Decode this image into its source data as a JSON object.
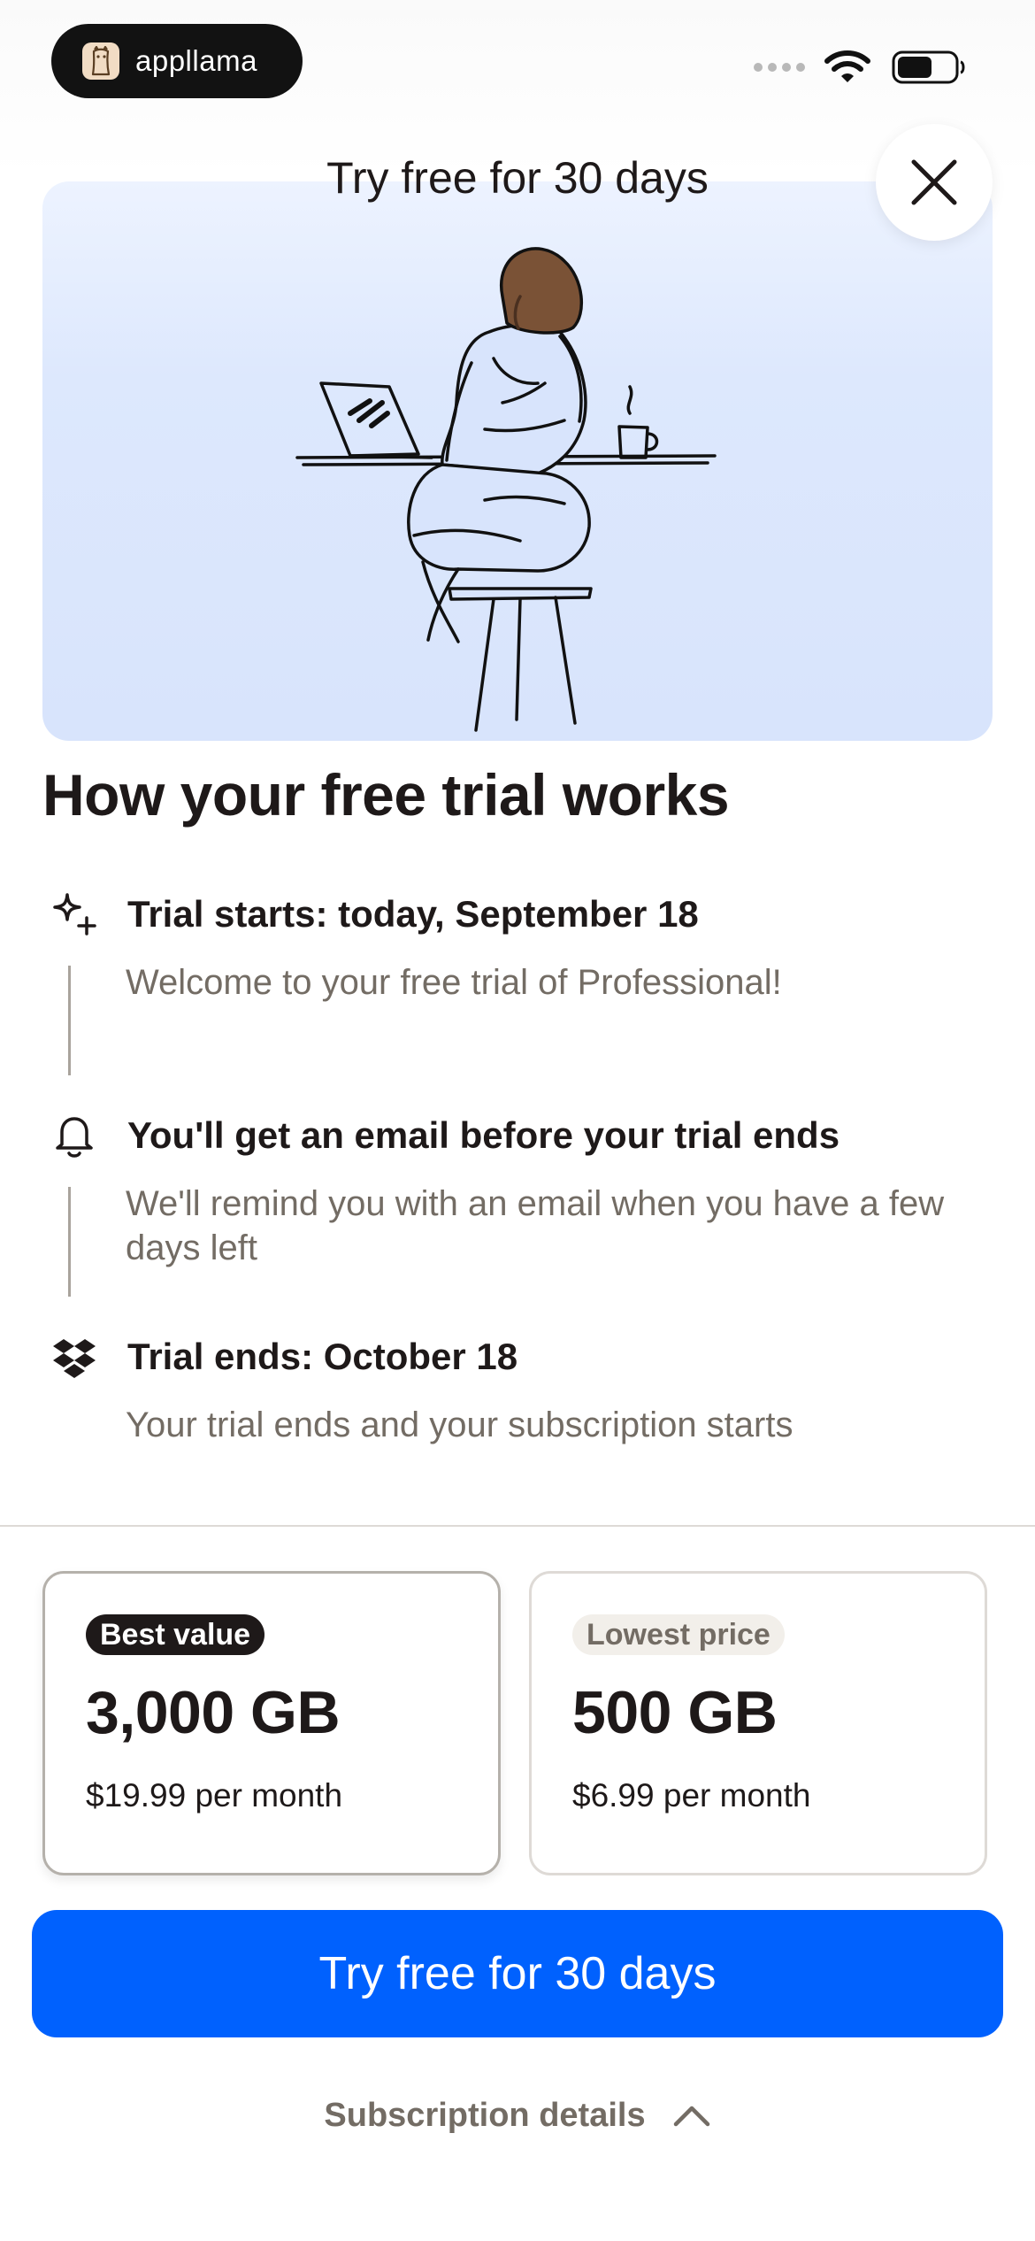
{
  "status_bar": {
    "brand_name": "appllama"
  },
  "header": {
    "title": "Try free for 30 days"
  },
  "how_it_works": {
    "title": "How your free trial works",
    "steps": [
      {
        "icon": "sparkle-icon",
        "title": "Trial starts: today, September 18",
        "description": "Welcome to your free trial of Professional!"
      },
      {
        "icon": "bell-icon",
        "title": "You'll get an email before your trial ends",
        "description": "We'll remind you with an email when you have a few days left"
      },
      {
        "icon": "dropbox-icon",
        "title": "Trial ends: October 18",
        "description": "Your trial ends and your subscription starts"
      }
    ]
  },
  "plans": [
    {
      "badge": "Best value",
      "size": "3,000 GB",
      "price": "$19.99",
      "period": " per month",
      "selected": true
    },
    {
      "badge": "Lowest price",
      "size": "500 GB",
      "price": "$6.99",
      "period": " per month",
      "selected": false
    }
  ],
  "cta": {
    "label": "Try free for 30 days"
  },
  "footer": {
    "subscription_details": "Subscription details"
  },
  "colors": {
    "primary": "#0061fe",
    "text": "#1e1919",
    "muted_text": "#736c64",
    "hero_background": "#d8e4fc"
  }
}
